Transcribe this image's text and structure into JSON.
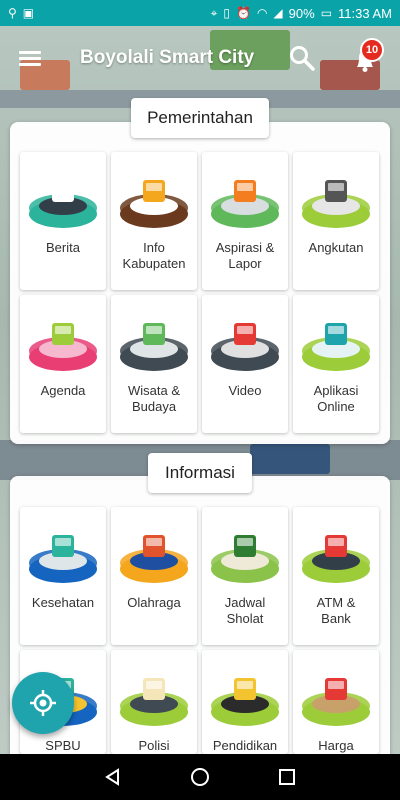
{
  "status_bar": {
    "battery": "90%",
    "time": "11:33 AM"
  },
  "header": {
    "title": "Boyolali Smart City",
    "notification_count": "10"
  },
  "sections": [
    {
      "title": "Pemerintahan",
      "items": [
        {
          "label": "Berita",
          "icon": "news-icon"
        },
        {
          "label": "Info\nKabupaten",
          "icon": "info-kabupaten-icon"
        },
        {
          "label": "Aspirasi &\nLapor",
          "icon": "aspiration-icon"
        },
        {
          "label": "Angkutan",
          "icon": "bus-icon"
        },
        {
          "label": "Agenda",
          "icon": "agenda-icon"
        },
        {
          "label": "Wisata &\nBudaya",
          "icon": "tourism-icon"
        },
        {
          "label": "Video",
          "icon": "video-icon"
        },
        {
          "label": "Aplikasi\nOnline",
          "icon": "online-app-icon"
        }
      ]
    },
    {
      "title": "Informasi",
      "items": [
        {
          "label": "Kesehatan",
          "icon": "health-icon"
        },
        {
          "label": "Olahraga",
          "icon": "sports-icon"
        },
        {
          "label": "Jadwal\nSholat",
          "icon": "mosque-icon"
        },
        {
          "label": "ATM &\nBank",
          "icon": "atm-icon"
        },
        {
          "label": "SPBU",
          "icon": "gas-station-icon"
        },
        {
          "label": "Polisi",
          "icon": "police-icon"
        },
        {
          "label": "Pendidikan",
          "icon": "education-icon"
        },
        {
          "label": "Harga",
          "icon": "price-icon"
        }
      ]
    }
  ],
  "colors": {
    "status_bar": "#0aa3a8",
    "fab": "#1fa4ad",
    "badge": "#e52b1f"
  }
}
